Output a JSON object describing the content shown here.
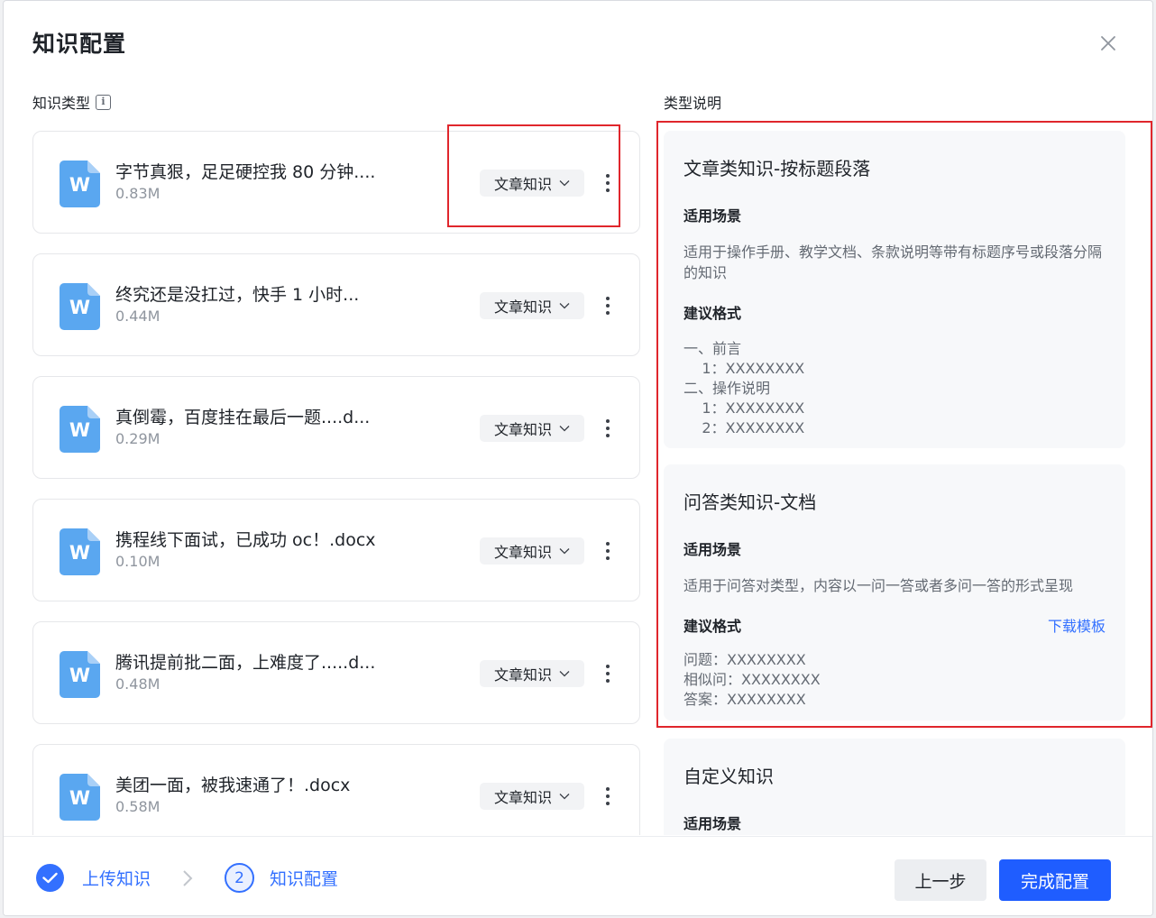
{
  "modal": {
    "title": "知识配置"
  },
  "left": {
    "label": "知识类型",
    "info_icon": "i"
  },
  "right": {
    "label": "类型说明"
  },
  "files": [
    {
      "icon_letter": "W",
      "name": "字节真狠，足足硬控我 80 分钟....",
      "size": "0.83M",
      "type": "文章知识"
    },
    {
      "icon_letter": "W",
      "name": "终究还是没扛过，快手 1 小时...",
      "size": "0.44M",
      "type": "文章知识"
    },
    {
      "icon_letter": "W",
      "name": "真倒霉，百度挂在最后一题....d...",
      "size": "0.29M",
      "type": "文章知识"
    },
    {
      "icon_letter": "W",
      "name": "携程线下面试，已成功 oc！.docx",
      "size": "0.10M",
      "type": "文章知识"
    },
    {
      "icon_letter": "W",
      "name": "腾讯提前批二面，上难度了.....d...",
      "size": "0.48M",
      "type": "文章知识"
    },
    {
      "icon_letter": "W",
      "name": "美团一面，被我速通了！.docx",
      "size": "0.58M",
      "type": "文章知识"
    }
  ],
  "descriptions": {
    "article": {
      "title": "文章类知识-按标题段落",
      "scene_label": "适用场景",
      "scene_text": "适用于操作手册、教学文档、条款说明等带有标题序号或段落分隔的知识",
      "format_label": "建议格式",
      "format_lines": [
        "一、前言",
        "    1：XXXXXXXX",
        "二、操作说明",
        "    1：XXXXXXXX",
        "    2：XXXXXXXX"
      ]
    },
    "qa": {
      "title": "问答类知识-文档",
      "scene_label": "适用场景",
      "scene_text": "适用于问答对类型，内容以一问一答或者多问一答的形式呈现",
      "format_label": "建议格式",
      "download_label": "下载模板",
      "format_lines": [
        "问题：XXXXXXXX",
        "相似问：XXXXXXXX",
        "答案：XXXXXXXX"
      ]
    },
    "custom": {
      "title": "自定义知识",
      "scene_label": "适用场景"
    }
  },
  "footer": {
    "step1_label": "上传知识",
    "step2_num": "2",
    "step2_label": "知识配置",
    "prev_label": "上一步",
    "done_label": "完成配置"
  },
  "colors": {
    "accent": "#3370ff",
    "primary_button": "#1f5dff",
    "highlight": "#e0262c",
    "word_icon": "#5aa7f0"
  }
}
